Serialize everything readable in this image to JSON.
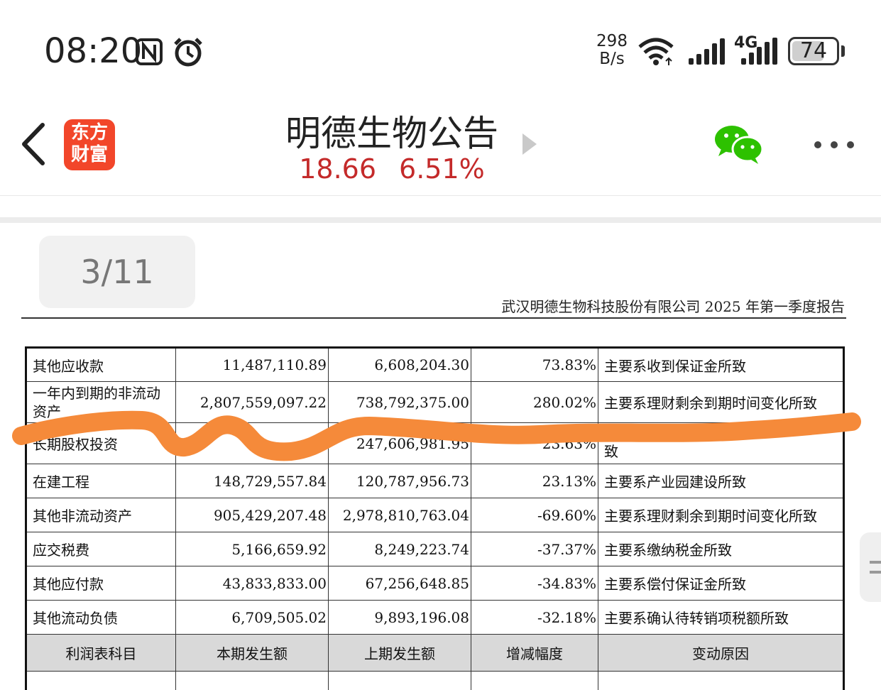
{
  "status_bar": {
    "time": "08:20",
    "net_speed_value": "298",
    "net_speed_unit": "B/s",
    "network_type": "4G",
    "battery": "74",
    "icons": [
      "nfc-icon",
      "alarm-icon",
      "wifi-icon",
      "signal-icon",
      "signal-4g-icon",
      "battery-icon"
    ]
  },
  "header": {
    "app_logo_line1": "东方",
    "app_logo_line2": "财富",
    "title": "明德生物公告",
    "price": "18.66",
    "change_pct": "6.51%"
  },
  "pager": {
    "indicator": "3/11"
  },
  "document": {
    "running_header": "武汉明德生物科技股份有限公司 2025 年第一季度报告",
    "rows": [
      {
        "item": "其他应收款",
        "current": "11,487,110.89",
        "previous": "6,608,204.30",
        "change": "73.83%",
        "reason": "主要系收到保证金所致"
      },
      {
        "item": "一年内到期的非流动资产",
        "current": "2,807,559,097.22",
        "previous": "738,792,375.00",
        "change": "280.02%",
        "reason": "主要系理财剩余到期时间变化所致"
      },
      {
        "item": "长期股权投资",
        "current": "",
        "previous": "247,606,981.95",
        "change": "23.63%",
        "reason": "致"
      },
      {
        "item": "在建工程",
        "current": "148,729,557.84",
        "previous": "120,787,956.73",
        "change": "23.13%",
        "reason": "主要系产业园建设所致"
      },
      {
        "item": "其他非流动资产",
        "current": "905,429,207.48",
        "previous": "2,978,810,763.04",
        "change": "-69.60%",
        "reason": "主要系理财剩余到期时间变化所致"
      },
      {
        "item": "应交税费",
        "current": "5,166,659.92",
        "previous": "8,249,223.74",
        "change": "-37.37%",
        "reason": "主要系缴纳税金所致"
      },
      {
        "item": "其他应付款",
        "current": "43,833,833.00",
        "previous": "67,256,648.85",
        "change": "-34.83%",
        "reason": "主要系偿付保证金所致"
      },
      {
        "item": "其他流动负债",
        "current": "6,709,505.02",
        "previous": "9,893,196.08",
        "change": "-32.18%",
        "reason": "主要系确认待转销项税额所致"
      }
    ],
    "income_header": [
      "利润表科目",
      "本期发生额",
      "上期发生额",
      "增减幅度",
      "变动原因"
    ]
  },
  "colors": {
    "price_red": "#c42a2a",
    "logo_orange": "#f2462a",
    "scribble_orange": "#f58a3a",
    "wechat_green": "#2dc100"
  }
}
